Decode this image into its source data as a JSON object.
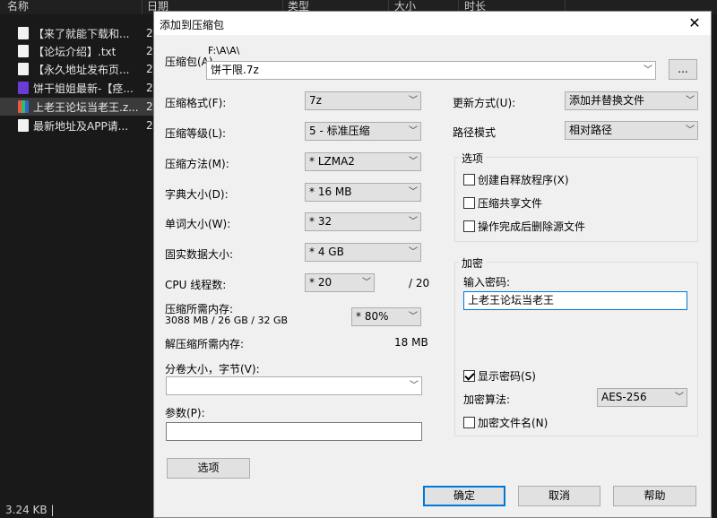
{
  "explorer": {
    "headers": [
      "名称",
      "日期",
      "类型",
      "大小",
      "时长"
    ],
    "files": [
      {
        "name": "【来了就能下载和...",
        "date": "2",
        "icon": "doc"
      },
      {
        "name": "【论坛介绍】.txt",
        "date": "2",
        "icon": "doc"
      },
      {
        "name": "【永久地址发布页...",
        "date": "2",
        "icon": "doc"
      },
      {
        "name": "饼干姐姐最新-【痉...",
        "date": "2",
        "icon": "mp4"
      },
      {
        "name": "上老王论坛当老王.z...",
        "date": "2",
        "icon": "zip",
        "selected": true
      },
      {
        "name": "最新地址及APP请...",
        "date": "2",
        "icon": "doc"
      }
    ],
    "status": "3.24 KB  |"
  },
  "dialog": {
    "title": "添加到压缩包",
    "close": "✕",
    "archive_label": "压缩包(A)",
    "archive_path": "F:\\A\\A\\",
    "archive_name": "饼干限.7z",
    "browse": "...",
    "left": {
      "format_label": "压缩格式(F):",
      "format_value": "7z",
      "level_label": "压缩等级(L):",
      "level_value": "5 - 标准压缩",
      "method_label": "压缩方法(M):",
      "method_value": "* LZMA2",
      "dict_label": "字典大小(D):",
      "dict_value": "* 16 MB",
      "word_label": "单词大小(W):",
      "word_value": "* 32",
      "solid_label": "固实数据大小:",
      "solid_value": "* 4 GB",
      "cpu_label": "CPU 线程数:",
      "cpu_value": "* 20",
      "cpu_max": "/ 20",
      "mem_label": "压缩所需内存:",
      "mem_detail": "3088 MB / 26 GB / 32 GB",
      "mem_value": "* 80%",
      "decomp_label": "解压缩所需内存:",
      "decomp_value": "18 MB",
      "split_label": "分卷大小，字节(V):",
      "split_value": "",
      "params_label": "参数(P):",
      "params_value": "",
      "options_btn": "选项"
    },
    "right": {
      "update_label": "更新方式(U):",
      "update_value": "添加并替换文件",
      "path_label": "路径模式",
      "path_value": "相对路径",
      "options_title": "选项",
      "opt_sfx": "创建自释放程序(X)",
      "opt_shared": "压缩共享文件",
      "opt_delete": "操作完成后删除源文件",
      "enc_title": "加密",
      "pwd_label": "输入密码:",
      "pwd_value": "上老王论坛当老王",
      "show_pwd": "显示密码(S)",
      "enc_method_label": "加密算法:",
      "enc_method_value": "AES-256",
      "enc_names": "加密文件名(N)"
    },
    "buttons": {
      "ok": "确定",
      "cancel": "取消",
      "help": "帮助"
    }
  }
}
